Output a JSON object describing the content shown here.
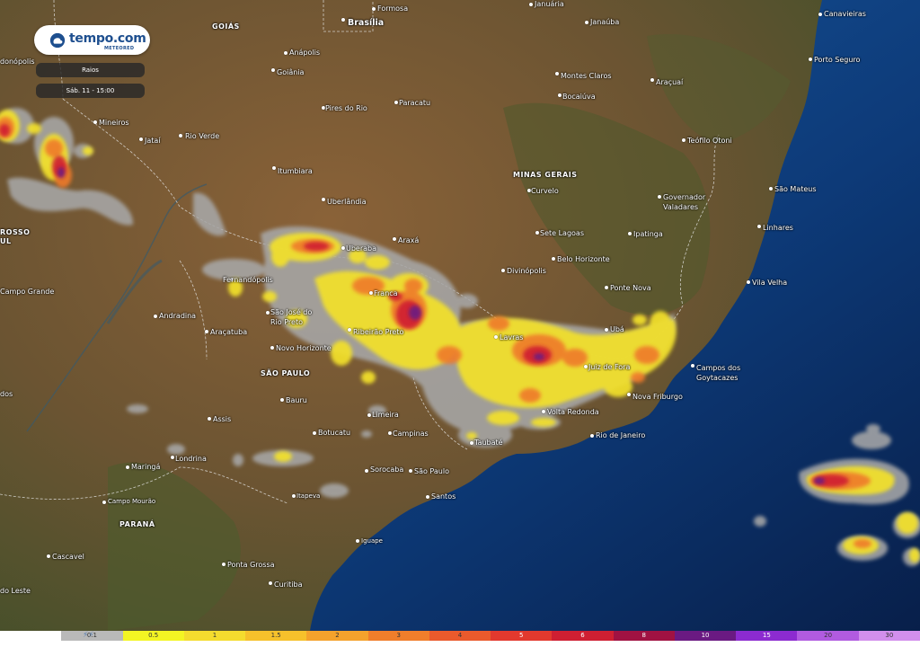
{
  "app": {
    "brand": "tempo.com",
    "brand_sub": "METEORED"
  },
  "layer_label": "Raios",
  "time_label": "Sáb. 11 - 15:00",
  "colors": {
    "ocean": "#0d3a78",
    "land": "#6b5432",
    "brand": "#1e4f8f",
    "rain_gray": "#a7a7a7"
  },
  "legend": {
    "icon": "lightning-icon",
    "items": [
      {
        "label": "",
        "color": "#ffffff"
      },
      {
        "label": "0.1",
        "color": "#b9b9b9"
      },
      {
        "label": "0.5",
        "color": "#f3f523"
      },
      {
        "label": "1",
        "color": "#f4dc2e"
      },
      {
        "label": "1.5",
        "color": "#f6c12b"
      },
      {
        "label": "2",
        "color": "#f4a22c"
      },
      {
        "label": "3",
        "color": "#f07e2b"
      },
      {
        "label": "4",
        "color": "#ea5a2c"
      },
      {
        "label": "5",
        "color": "#e2392e"
      },
      {
        "label": "6",
        "color": "#cf1f32"
      },
      {
        "label": "8",
        "color": "#a01242"
      },
      {
        "label": "10",
        "color": "#6a1a82"
      },
      {
        "label": "15",
        "color": "#8c2bd0"
      },
      {
        "label": "20",
        "color": "#b15be0"
      },
      {
        "label": "30",
        "color": "#d28fec"
      }
    ]
  },
  "states": [
    "GOIÁS",
    "MINAS GERAIS",
    "SÃO PAULO",
    "PARANÁ",
    "ROSSO",
    "UL"
  ],
  "capital": "Brasília",
  "cities": [
    "Formosa",
    "Januária",
    "Janaúba",
    "Canavieiras",
    "donópolis",
    "Anápolis",
    "Goiânia",
    "Montes Claros",
    "Araçuaí",
    "Porto Seguro",
    "Mineiros",
    "Pires do Rio",
    "Paracatu",
    "Bocaiúva",
    "Jataí",
    "Rio Verde",
    "Teófilo Otoni",
    "Itumbiara",
    "Curvelo",
    "São Mateus",
    "Uberlândia",
    "Governador Valadares",
    "Linhares",
    "Sete Lagoas",
    "Ipatinga",
    "Uberaba",
    "Araxá",
    "Belo Horizonte",
    "Divinópolis",
    "Fernandópolis",
    "Vila Velha",
    "Franca",
    "Ponte Nova",
    "Campo Grande",
    "São José do Rio Preto",
    "Andradina",
    "Ubá",
    "Lavras",
    "Ribeirão Preto",
    "Araçatuba",
    "Novo Horizonte",
    "Juiz de Fora",
    "Campos dos Goytacazes",
    "Nova Friburgo",
    "Bauru",
    "Volta Redonda",
    "dos",
    "Limeira",
    "Assis",
    "Botucatu",
    "Campinas",
    "Rio de Janeiro",
    "Taubaté",
    "Londrina",
    "Maringá",
    "Sorocaba",
    "São Paulo",
    "Itapeva",
    "Santos",
    "Campo Mourão",
    "Cascavel",
    "Iguape",
    "Ponta Grossa",
    "Curitiba",
    "do Leste"
  ]
}
